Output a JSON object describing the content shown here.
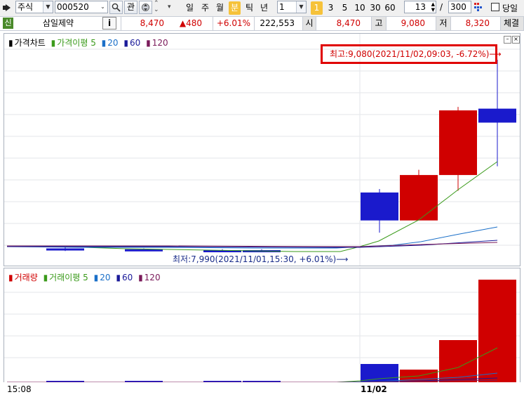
{
  "toolbar": {
    "market": "주식",
    "code": "000520",
    "search_icon": "magnifier-icon",
    "interest_label": "관",
    "periods": [
      "일",
      "주",
      "월",
      "분",
      "틱",
      "년"
    ],
    "selected_period": "분",
    "interval_value": "1",
    "quick_intervals": [
      "1",
      "3",
      "5",
      "10",
      "30",
      "60"
    ],
    "selected_quick": "1",
    "count_value": "13",
    "separator": "/",
    "total_value": "300",
    "today_label": "당일"
  },
  "info": {
    "badge": "신",
    "name": "삼일제약",
    "info_button": "i",
    "price": "8,470",
    "change": "▲480",
    "change_pct": "+6.01%",
    "volume": "222,553",
    "open_label": "시",
    "open": "8,470",
    "high_label": "고",
    "high": "9,080",
    "low_label": "저",
    "low": "8,320",
    "trade_label": "체결",
    "colors": {
      "up": "#d00000",
      "down": "#1a1acc"
    }
  },
  "price_panel": {
    "legend": [
      {
        "label": "가격차트",
        "color": "#000000"
      },
      {
        "label": "가격이평 5",
        "color": "#3a9a1a"
      },
      {
        "label": "20",
        "color": "#1a6fc8"
      },
      {
        "label": "60",
        "color": "#1a1a99"
      },
      {
        "label": "120",
        "color": "#7a1a5a"
      }
    ],
    "high_annotation": "최고:9,080(2021/11/02,09:03, -6.72%)⟶",
    "low_annotation": "최저:7,990(2021/11/01,15:30, +6.01%)⟶"
  },
  "volume_panel": {
    "legend": [
      {
        "label": "거래량",
        "color": "#d00000"
      },
      {
        "label": "거래이평 5",
        "color": "#3a9a1a"
      },
      {
        "label": "20",
        "color": "#1a6fc8"
      },
      {
        "label": "60",
        "color": "#1a1a99"
      },
      {
        "label": "120",
        "color": "#7a1a5a"
      }
    ]
  },
  "x_axis": {
    "labels": [
      "15:08",
      "11/02"
    ]
  },
  "chart_data": {
    "type": "candlestick",
    "candles": [
      {
        "o": 8000,
        "h": 8010,
        "l": 7985,
        "c": 7995,
        "dir": "down"
      },
      {
        "o": 7995,
        "h": 8000,
        "l": 7990,
        "c": 7990,
        "dir": "down"
      },
      {
        "o": 7990,
        "h": 7995,
        "l": 7990,
        "c": 7990,
        "dir": "down"
      },
      {
        "o": 7990,
        "h": 7995,
        "l": 7985,
        "c": 7990,
        "dir": "down"
      },
      {
        "o": 8320,
        "h": 8340,
        "l": 8090,
        "c": 8160,
        "dir": "down"
      },
      {
        "o": 8160,
        "h": 8450,
        "l": 8160,
        "c": 8420,
        "dir": "up"
      },
      {
        "o": 8420,
        "h": 8810,
        "l": 8330,
        "c": 8790,
        "dir": "up"
      },
      {
        "o": 8800,
        "h": 9080,
        "l": 8470,
        "c": 8720,
        "dir": "down"
      }
    ],
    "volume_bars": [
      2,
      2,
      2,
      2,
      26,
      18,
      60,
      146
    ],
    "high": 9080,
    "low": 7990
  }
}
